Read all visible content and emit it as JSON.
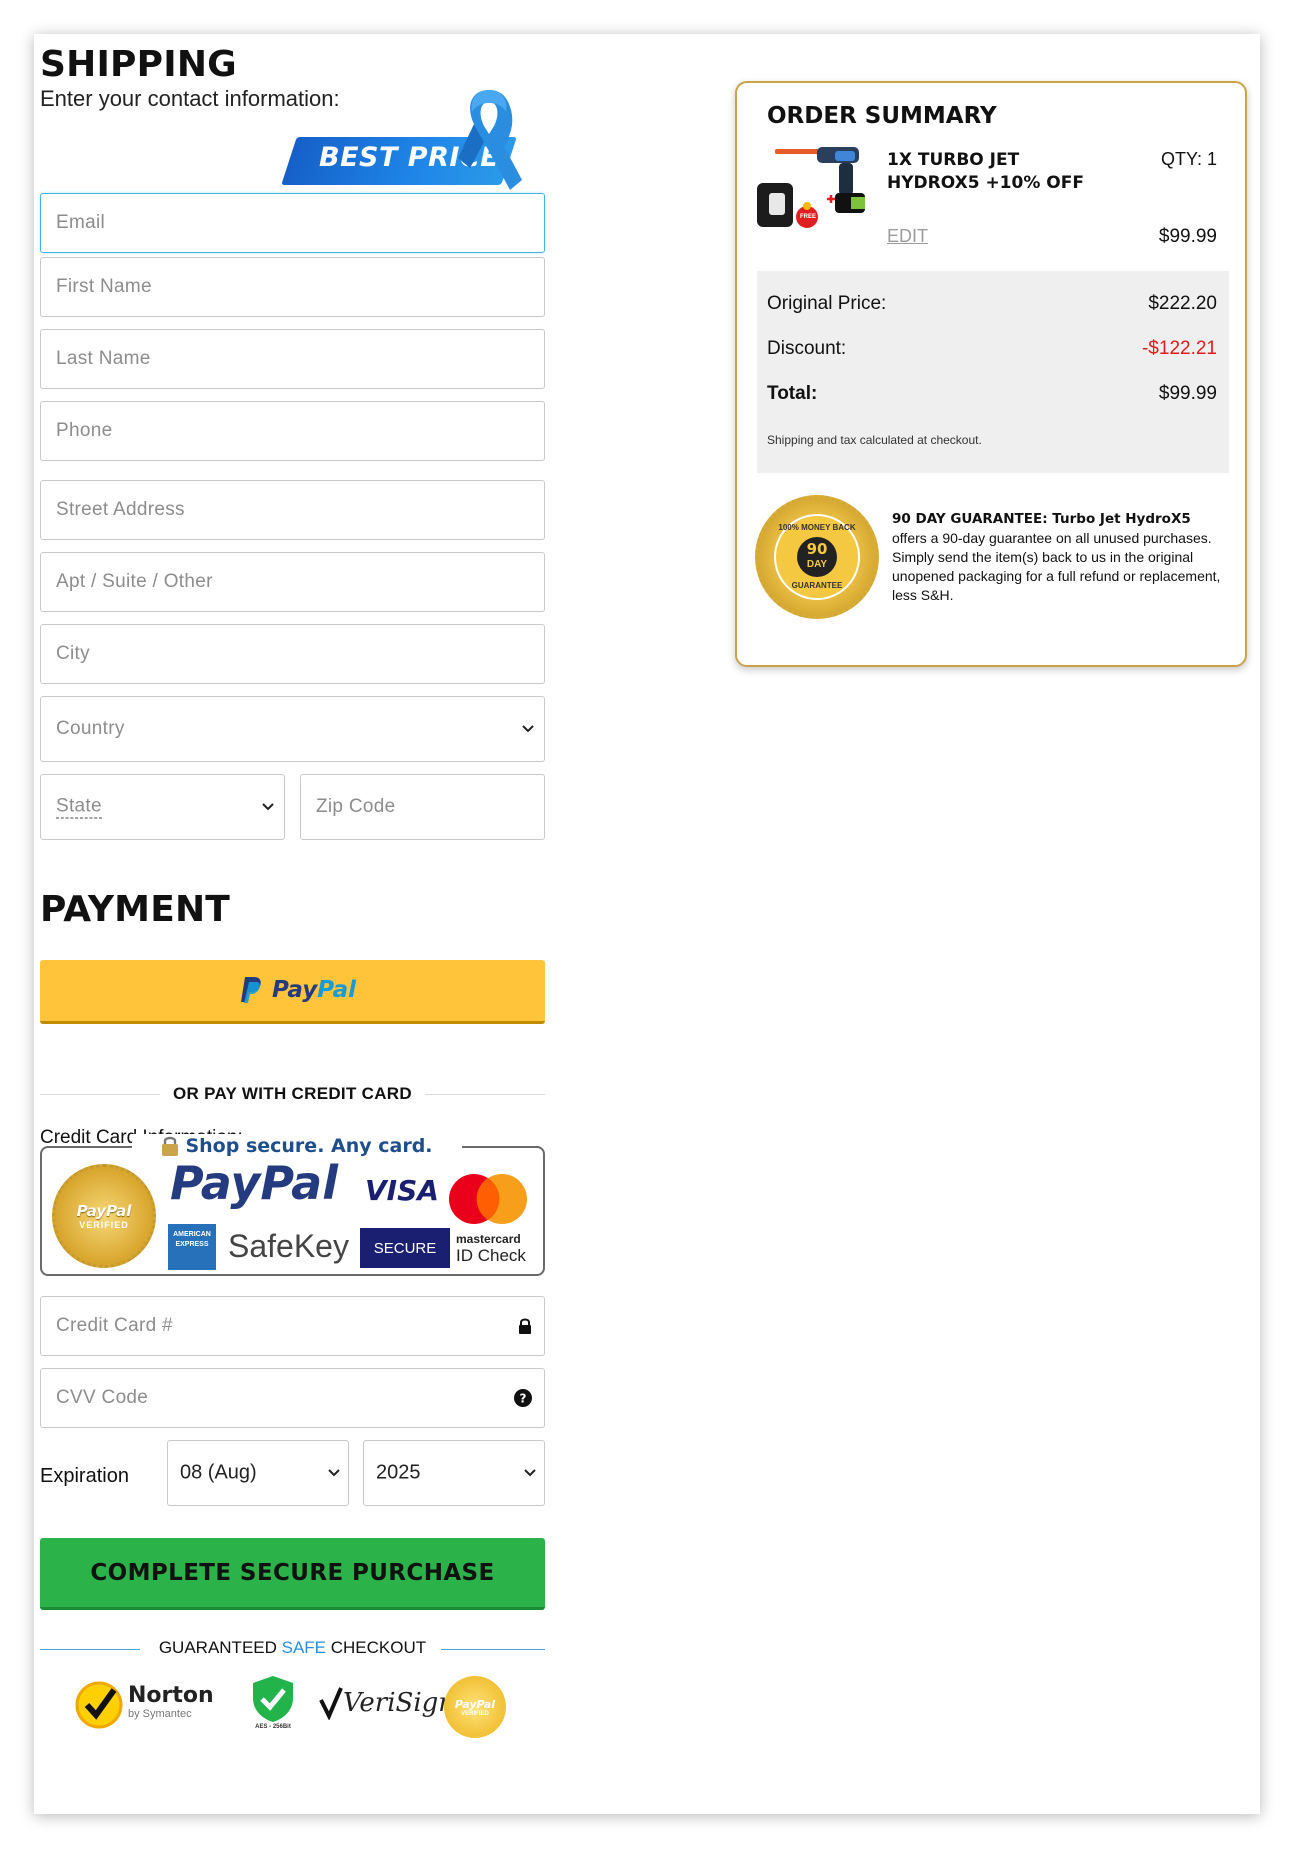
{
  "shipping": {
    "title": "SHIPPING",
    "subtitle": "Enter your contact information:",
    "badge": "BEST PRICE",
    "fields": {
      "email": "Email",
      "first_name": "First Name",
      "last_name": "Last Name",
      "phone": "Phone",
      "street": "Street Address",
      "apt": "Apt / Suite / Other",
      "city": "City",
      "country": "Country",
      "state": "State",
      "zip": "Zip Code"
    }
  },
  "payment": {
    "title": "PAYMENT",
    "paypal_label": "PayPal",
    "or_text": "OR PAY WITH CREDIT CARD",
    "cc_info": "Credit Card Information:",
    "trust": {
      "headline": "Shop secure. Any card.",
      "paypal_big": "PayPal",
      "visa": "VISA",
      "safekey": "SafeKey",
      "secure": "SECURE",
      "mastercard": "mastercard",
      "idcheck": "ID Check",
      "seal_top": "PayPal",
      "seal_bottom": "VERIFIED",
      "amex": "AMERICAN EXPRESS"
    },
    "card_number": "Credit Card #",
    "cvv": "CVV Code",
    "expiration_label": "Expiration",
    "exp_month": "08 (Aug)",
    "exp_year": "2025",
    "buy_button": "COMPLETE SECURE PURCHASE",
    "guarantee_prefix": "GUARANTEED ",
    "guarantee_safe": "SAFE",
    "guarantee_suffix": " CHECKOUT",
    "badges": {
      "norton": "Norton",
      "norton_sub": "by Symantec",
      "aes": "AES - 256Bit",
      "verisign": "VeriSign",
      "pp_seal": "PayPal",
      "pp_seal_sub": "VERIFIED"
    }
  },
  "summary": {
    "title": "ORDER SUMMARY",
    "product_line1": "1X TURBO JET",
    "product_line2": "HYDROX5 +10% OFF",
    "qty": "QTY: 1",
    "edit": "EDIT",
    "line_price": "$99.99",
    "free_tag": "FREE",
    "original_label": "Original Price:",
    "original_value": "$222.20",
    "discount_label": "Discount:",
    "discount_value": "-$122.21",
    "total_label": "Total:",
    "total_value": "$99.99",
    "note": "Shipping and tax calculated at checkout.",
    "seal_top": "100% MONEY BACK",
    "seal_num": "90",
    "seal_day": "DAY",
    "seal_bottom": "GUARANTEE",
    "guarantee_bold": "90 DAY GUARANTEE: Turbo Jet HydroX5",
    "guarantee_text": "offers a 90-day guarantee on all unused purchases. Simply send the item(s) back to us in the original unopened packaging for a full refund or replacement, less S&H."
  },
  "colors": {
    "paypal_yellow": "#ffc439",
    "buy_green": "#2bb34a",
    "discount_red": "#e01b1b",
    "summary_border": "#caa34a",
    "focus_blue": "#43b4e6",
    "badge_blue": "#1f86e8"
  }
}
